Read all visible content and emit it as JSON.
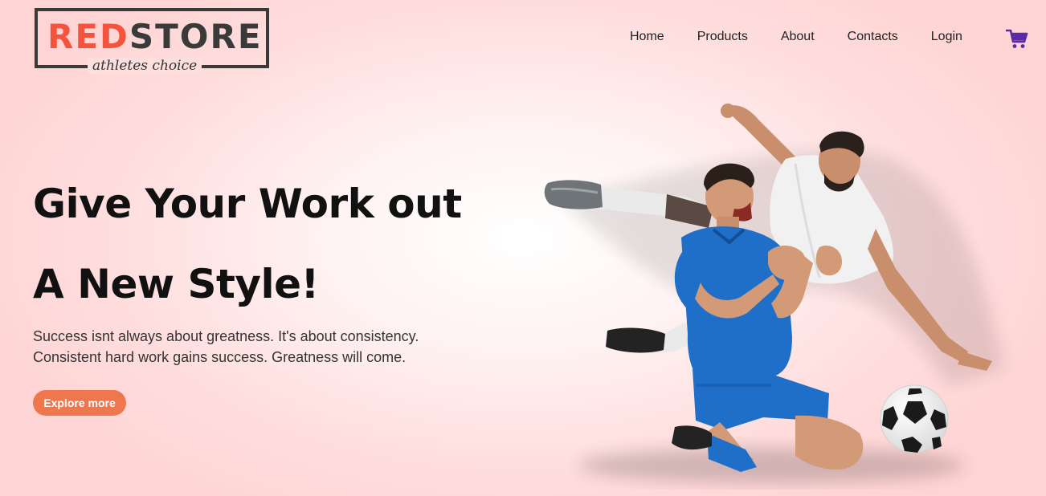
{
  "brand": {
    "name_red": "RED",
    "name_dark": "STORE",
    "tagline": "athletes choice",
    "colors": {
      "accent": "#f2553b",
      "dark": "#3a3a3a"
    }
  },
  "nav": {
    "items": [
      "Home",
      "Products",
      "About",
      "Contacts",
      "Login"
    ],
    "cart_icon": "cart-icon",
    "cart_color": "#5b2aa6"
  },
  "hero": {
    "title_line1": "Give Your Work out",
    "title_line2": "A New Style!",
    "subtitle_line1": "Success isnt always about greatness. It's about consistency.",
    "subtitle_line2": "Consistent hard work gains success. Greatness will come.",
    "cta_label": "Explore more",
    "cta_color": "#ee774d",
    "image": "two-football-players-image"
  }
}
